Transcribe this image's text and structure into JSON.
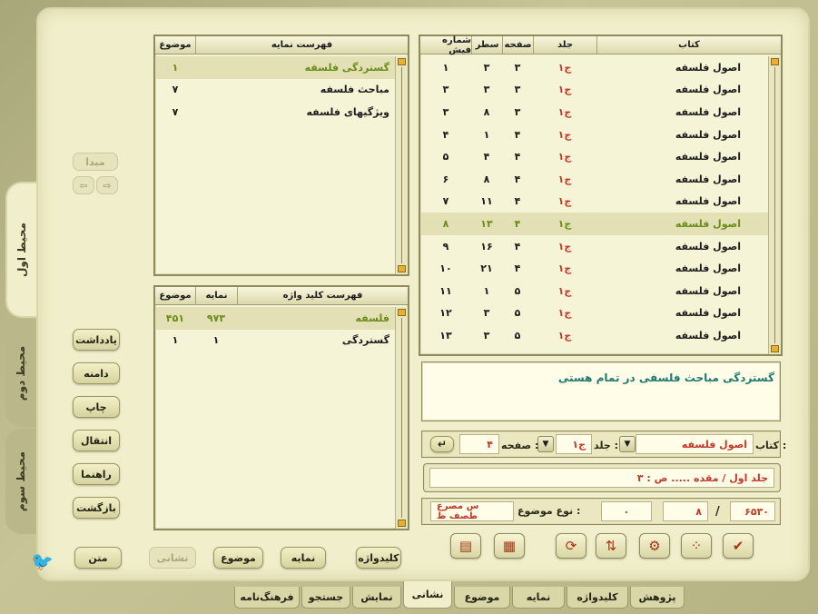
{
  "side_tabs": [
    "محیط اول",
    "محیط دوم",
    "محیط سوم"
  ],
  "mabda": {
    "label": "مبدا",
    "arrow_left": "⇦",
    "arrow_right": "⇨"
  },
  "side_buttons": [
    "یادداشت",
    "دامنه",
    "چاپ",
    "انتقال",
    "راهنما",
    "بازگشت"
  ],
  "mid_buttons": [
    "کلیدواژه",
    "نمایه",
    "موضوع",
    "نشانی",
    "متن"
  ],
  "index_table": {
    "headers": [
      "فهرست نمایه",
      "موضوع"
    ],
    "rows": [
      {
        "title": "گستردگی فلسفه",
        "subject": "۱"
      },
      {
        "title": "مباحث فلسفه",
        "subject": "۷"
      },
      {
        "title": "ویژگیهای فلسفه",
        "subject": "۷"
      }
    ]
  },
  "keyword_table": {
    "headers": [
      "فهرست کلید واژه",
      "نمایه",
      "موضوع"
    ],
    "rows": [
      {
        "keyword": "فلسفه",
        "index": "۹۷۳",
        "subject": "۴۵۱"
      },
      {
        "keyword": "گستردگی",
        "index": "۱",
        "subject": "۱"
      }
    ]
  },
  "main_table": {
    "headers": [
      "کتاب",
      "جلد",
      "صفحه",
      "سطر",
      "شماره فیش"
    ],
    "rows": [
      {
        "book": "اصول فلسفه",
        "vol": "ج۱",
        "page": "۳",
        "line": "۳",
        "fish": "۱"
      },
      {
        "book": "اصول فلسفه",
        "vol": "ج۱",
        "page": "۳",
        "line": "۳",
        "fish": "۳"
      },
      {
        "book": "اصول فلسفه",
        "vol": "ج۱",
        "page": "۳",
        "line": "۸",
        "fish": "۳"
      },
      {
        "book": "اصول فلسفه",
        "vol": "ج۱",
        "page": "۴",
        "line": "۱",
        "fish": "۴"
      },
      {
        "book": "اصول فلسفه",
        "vol": "ج۱",
        "page": "۴",
        "line": "۴",
        "fish": "۵"
      },
      {
        "book": "اصول فلسفه",
        "vol": "ج۱",
        "page": "۴",
        "line": "۸",
        "fish": "۶"
      },
      {
        "book": "اصول فلسفه",
        "vol": "ج۱",
        "page": "۴",
        "line": "۱۱",
        "fish": "۷"
      },
      {
        "book": "اصول فلسفه",
        "vol": "ج۱",
        "page": "۴",
        "line": "۱۳",
        "fish": "۸"
      },
      {
        "book": "اصول فلسفه",
        "vol": "ج۱",
        "page": "۴",
        "line": "۱۶",
        "fish": "۹"
      },
      {
        "book": "اصول فلسفه",
        "vol": "ج۱",
        "page": "۴",
        "line": "۲۱",
        "fish": "۱۰"
      },
      {
        "book": "اصول فلسفه",
        "vol": "ج۱",
        "page": "۵",
        "line": "۱",
        "fish": "۱۱"
      },
      {
        "book": "اصول فلسفه",
        "vol": "ج۱",
        "page": "۵",
        "line": "۳",
        "fish": "۱۲"
      },
      {
        "book": "اصول فلسفه",
        "vol": "ج۱",
        "page": "۵",
        "line": "۳",
        "fish": "۱۳"
      }
    ]
  },
  "description_text": "گستردگی مباحث فلسفی در تمام هستی",
  "locator": {
    "book_label": "کتاب :",
    "book_value": "اصول فلسفه",
    "vol_label": "جلد :",
    "vol_value": "ج۱",
    "page_label": "صفحه :",
    "page_value": "۴",
    "enter_symbol": "↵"
  },
  "ref_text": "جلد اول / مقده ..... ص : ۳",
  "counters": {
    "total": "۶۵۳۰",
    "slash": "/",
    "current": "۸",
    "extra": "۰"
  },
  "topic_type": {
    "label": "نوع موضوع :",
    "value": "س مصرع طصف ظ"
  },
  "action_icons": [
    "copy-icon",
    "list-icon",
    "refresh-icon",
    "sort-icon",
    "filter-icon",
    "dots-icon",
    "check-icon"
  ],
  "bottom_tabs": [
    "پژوهش",
    "کلیدواژه",
    "نمایه",
    "موضوع",
    "نشانی",
    "نمایش",
    "جستجو",
    "فرهنگ‌نامه"
  ],
  "colors": {
    "accent": "#e6b033",
    "selected_text": "#6b8c1a",
    "number_red": "#c0392b",
    "desc_text": "#1e7a6e"
  }
}
